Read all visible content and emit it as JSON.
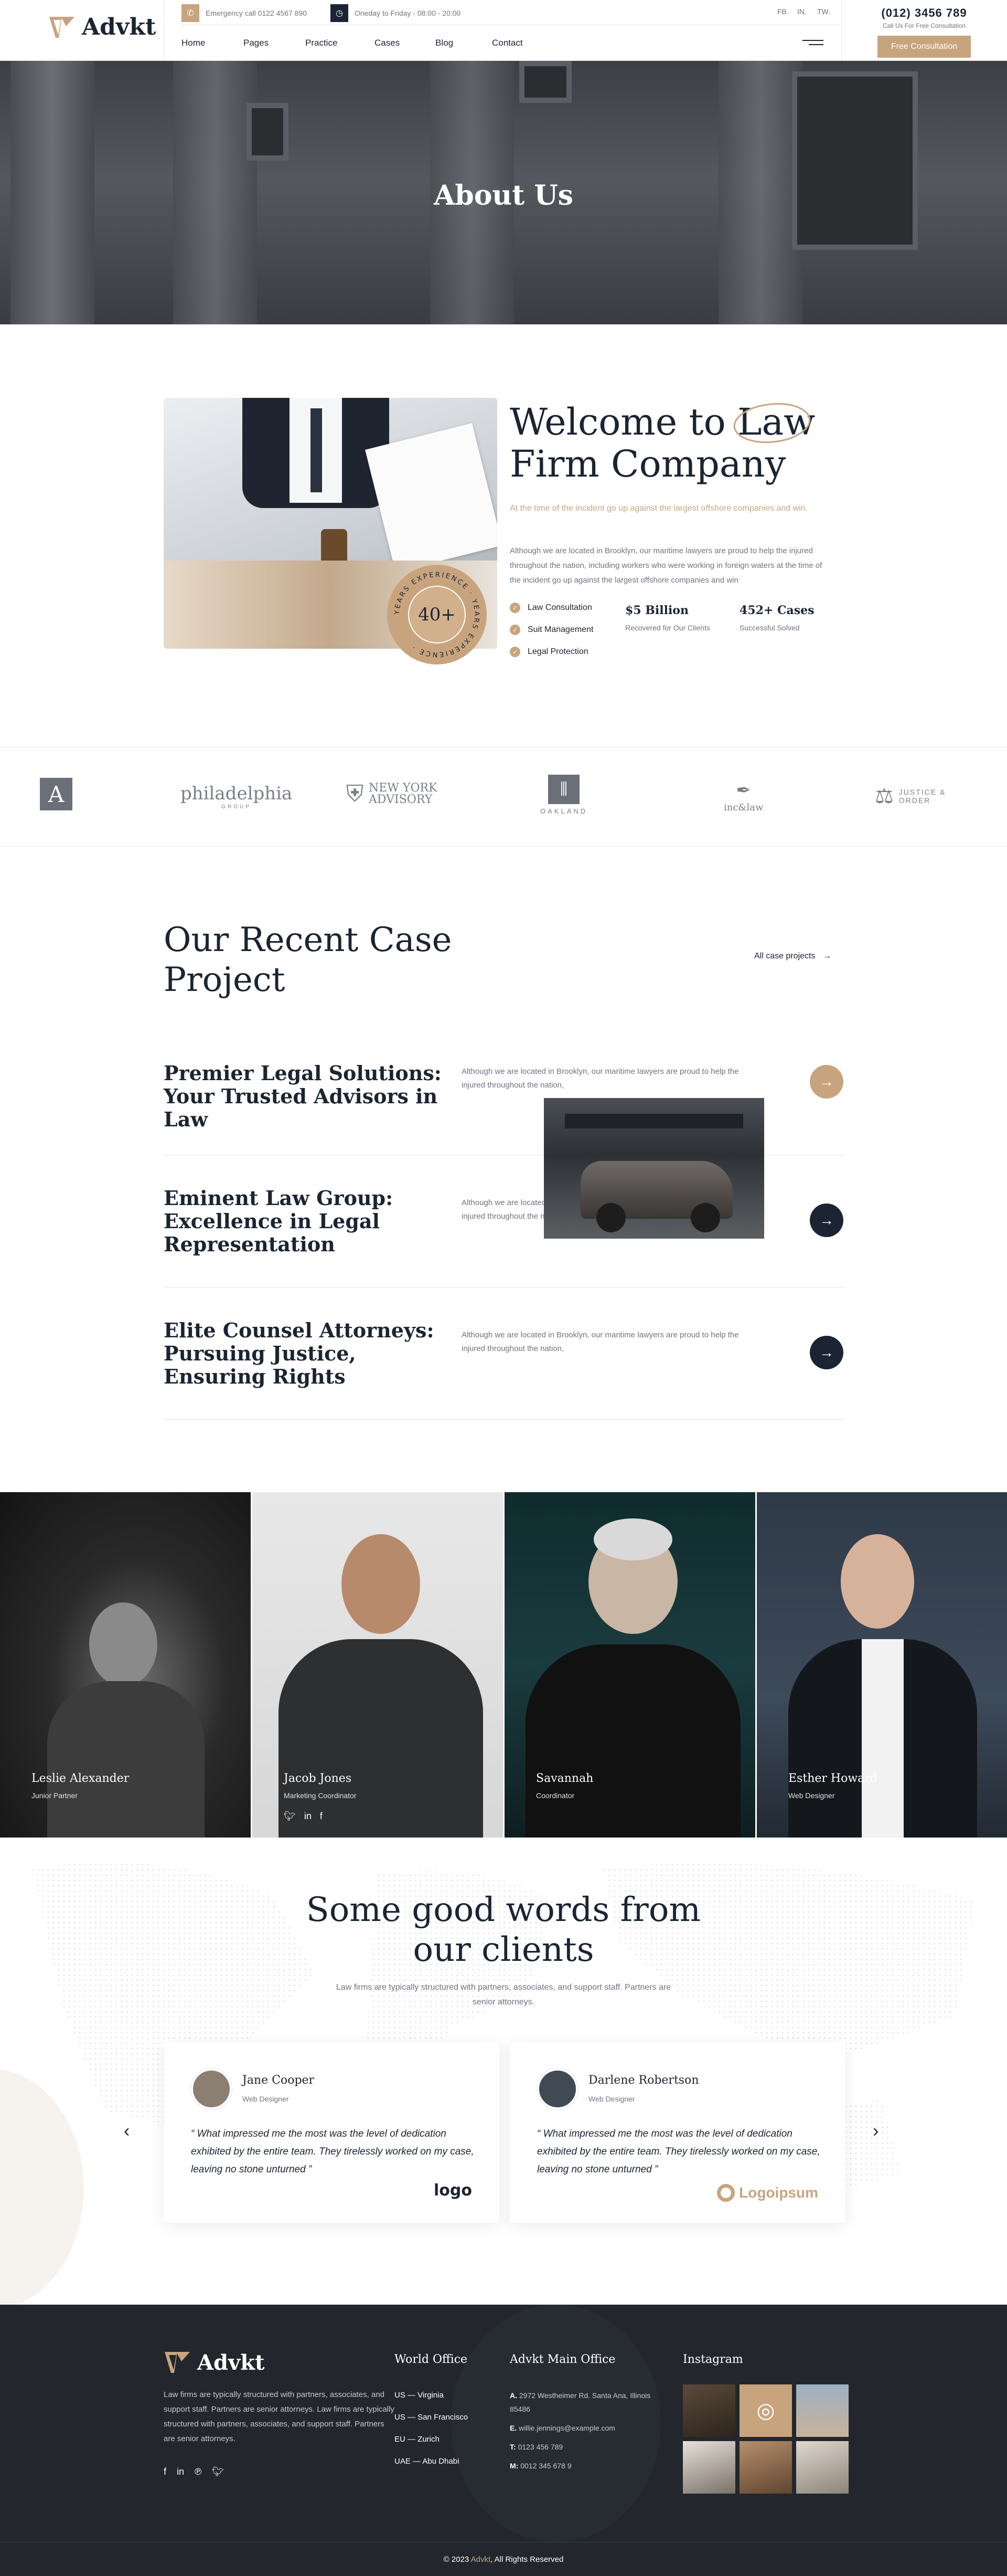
{
  "header": {
    "brand": "Advkt",
    "emergency": "Emergency call 0122 4567 890",
    "hours": "Oneday to Friday - 08:00 - 20:00",
    "social": [
      "FB.",
      "IN.",
      "TW."
    ],
    "phone": "(012) 3456 789",
    "phone_sub": "Call Us For Free Consultation",
    "cta": "Free Consultation",
    "nav": [
      "Home",
      "Pages",
      "Practice",
      "Cases",
      "Blog",
      "Contact"
    ]
  },
  "hero": {
    "title": "About Us"
  },
  "welcome": {
    "title_a": "Welcome to ",
    "title_highlight": "Law",
    "title_b": "Firm Company",
    "lead": "At the time of the incident go up against the largest offshore companies and win.",
    "desc": "Although we are located in Brooklyn, our maritime lawyers are proud to help the injured throughout the nation, including workers who were working in foreign waters at the time of the incident go up against the largest offshore companies and win",
    "badge_number": "40+",
    "badge_text": "YEARS EXPERIENCE · YEARS EXPERIENCE ·",
    "checks": [
      "Law Consultation",
      "Suit Management",
      "Legal Protection"
    ],
    "stats": [
      {
        "value": "$5 Billion",
        "label": "Recovered for Our Clients"
      },
      {
        "value": "452+ Cases",
        "label": "Successful Solved"
      }
    ]
  },
  "partners": [
    "A",
    "philadelphia",
    "NEW YORK ADVISORY",
    "OAKLAND",
    "inc&law",
    "JUSTICE & ORDER"
  ],
  "partners_sub": {
    "philadelphia": "GROUP"
  },
  "cases": {
    "title": "Our Recent Case Project",
    "link": "All case projects",
    "items": [
      {
        "title": "Premier Legal Solutions: Your Trusted Advisors in Law",
        "desc": "Although we are located in Brooklyn, our maritime lawyers are proud to help the injured throughout the nation,"
      },
      {
        "title": "Eminent Law Group: Excellence in Legal Representation",
        "desc": "Although we are located in Brooklyn, our maritime lawyers are proud to help the injured throughout the nation,"
      },
      {
        "title": "Elite Counsel Attorneys: Pursuing Justice, Ensuring Rights",
        "desc": "Although we are located in Brooklyn, our maritime lawyers are proud to help the injured throughout the nation,"
      }
    ]
  },
  "team": [
    {
      "name": "Leslie Alexander",
      "role": "Junior Partner"
    },
    {
      "name": "Jacob Jones",
      "role": "Marketing Coordinator"
    },
    {
      "name": "Savannah",
      "role": "Coordinator"
    },
    {
      "name": "Esther Howard",
      "role": "Web Designer"
    }
  ],
  "testimonials": {
    "title": "Some good words from our clients",
    "sub": "Law firms are typically structured with partners, associates, and support staff. Partners are senior attorneys.",
    "items": [
      {
        "name": "Jane Cooper",
        "role": "Web Designer",
        "quote": "“ What impressed me the most was the level of dedication exhibited by the entire team. They tirelessly worked on my case, leaving no stone unturned ”",
        "logo": "logo"
      },
      {
        "name": "Darlene Robertson",
        "role": "Web Designer",
        "quote": "“ What impressed me the most was the level of dedication exhibited by the entire team. They tirelessly worked on my case, leaving no stone unturned ”",
        "logo": "Logoipsum"
      }
    ]
  },
  "footer": {
    "brand": "Advkt",
    "desc": "Law firms are typically structured with partners, associates, and support staff. Partners are senior attorneys. Law firms are typically structured with partners, associates, and support staff. Partners are senior attorneys.",
    "world_office_title": "World Office",
    "world_offices": [
      "US — Virginia",
      "US — San Francisco",
      "EU — Zurich",
      "UAE — Abu Dhabi"
    ],
    "main_office_title": "Advkt Main Office",
    "main_office": [
      {
        "k": "A.",
        "v": "2972 Westheimer Rd. Santa Ana, Illinois 85486"
      },
      {
        "k": "E.",
        "v": "willie.jennings@example.com"
      },
      {
        "k": "T:",
        "v": "0123 456 789"
      },
      {
        "k": "M:",
        "v": "0012 345 678 9"
      }
    ],
    "instagram_title": "Instagram",
    "copyright_pre": "© 2023 ",
    "copyright_brand": "Advkt",
    "copyright_post": ", All Rights Reserved"
  },
  "colors": {
    "accent": "#c8a47e",
    "dark": "#1b2432",
    "footer": "#23272d"
  }
}
